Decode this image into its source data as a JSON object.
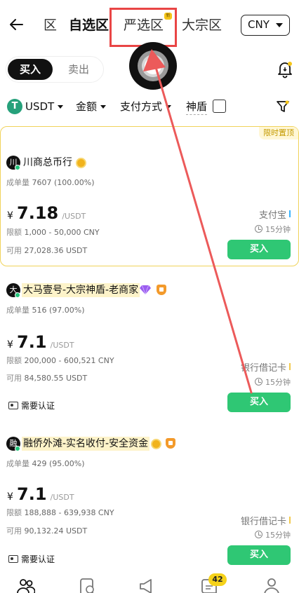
{
  "header": {
    "tabs": [
      {
        "label": "区"
      },
      {
        "label": "自选区"
      },
      {
        "label": "严选区",
        "badge": "新"
      },
      {
        "label": "大宗区"
      }
    ],
    "currency": "CNY"
  },
  "toggle": {
    "buy": "买入",
    "sell": "卖出"
  },
  "filters": {
    "asset": "USDT",
    "asset_icon": "T",
    "amount": "金额",
    "payment": "支付方式",
    "shield": "神盾"
  },
  "listings": [
    {
      "avatar": "川",
      "name": "川商总币行",
      "pin_label": "限时置顶",
      "orders_label": "成单量",
      "orders": "7607 (100.00%)",
      "currency_symbol": "¥",
      "price": "7.18",
      "unit": "/USDT",
      "limit_label": "限额",
      "limit": "1,000 - 50,000 CNY",
      "avail_label": "可用",
      "available": "27,028.36 USDT",
      "payment": "支付宝",
      "time": "15分钟",
      "buy": "买入"
    },
    {
      "avatar": "大",
      "name": "大马壹号-大宗神盾-老商家",
      "orders_label": "成单量",
      "orders": "516 (97.00%)",
      "currency_symbol": "¥",
      "price": "7.1",
      "unit": "/USDT",
      "limit_label": "限额",
      "limit": "200,000 - 600,521 CNY",
      "avail_label": "可用",
      "available": "84,580.55 USDT",
      "payment": "银行借记卡",
      "time": "15分钟",
      "kyc": "需要认证",
      "buy": "买入"
    },
    {
      "avatar": "融",
      "name": "融侨外滩-实名收付-安全资金",
      "orders_label": "成单量",
      "orders": "429 (95.00%)",
      "currency_symbol": "¥",
      "price": "7.1",
      "unit": "/USDT",
      "limit_label": "限额",
      "limit": "188,888 - 639,938 CNY",
      "avail_label": "可用",
      "available": "90,132.24 USDT",
      "payment": "银行借记卡",
      "time": "15分钟",
      "kyc": "需要认证",
      "buy": "买入"
    }
  ],
  "nav": {
    "badge": "42"
  },
  "colors": {
    "accent": "#2fc774",
    "highlight": "#e94545",
    "pin": "#f0d35a"
  }
}
